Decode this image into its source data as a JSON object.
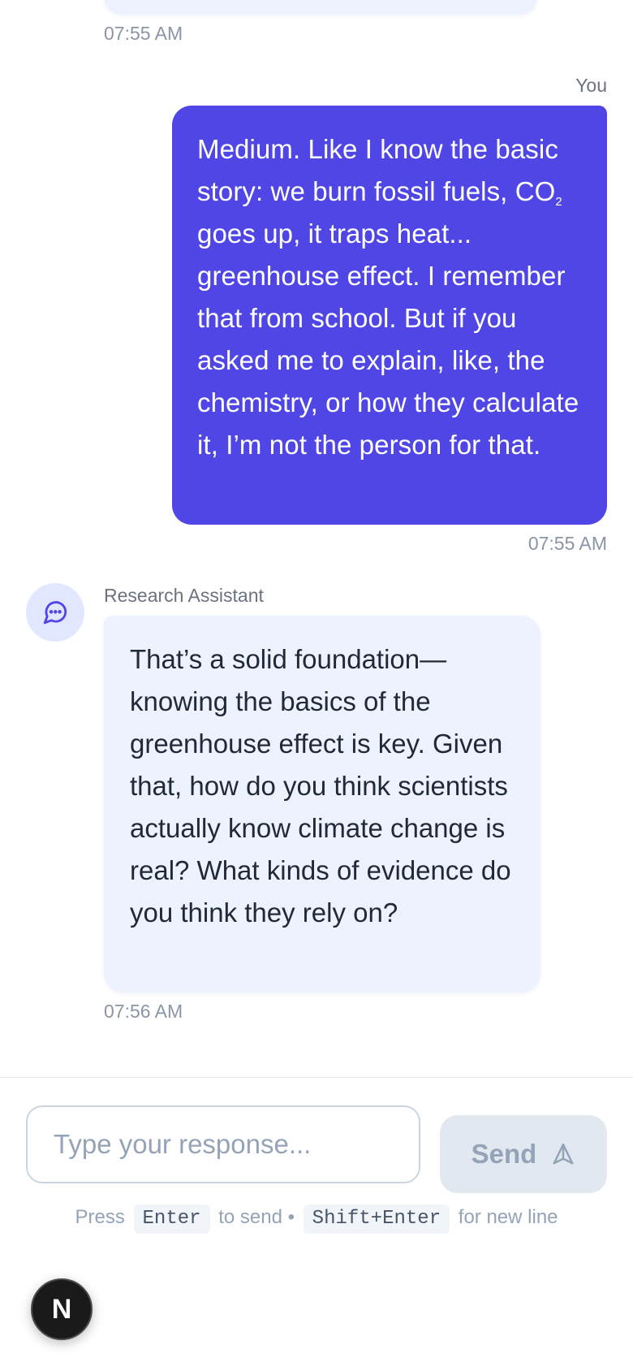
{
  "messages": {
    "previous": {
      "timestamp": "07:55 AM"
    },
    "user": {
      "sender": "You",
      "text_before_sub": "Medium. Like I know the basic story: we burn fossil fuels, CO",
      "subscript": "2",
      "text_after_sub": " goes up, it traps heat... greenhouse effect. I remember that from school. But if you asked me to explain, like, the chemistry, or how they calculate it, I’m not the person for that.",
      "timestamp": "07:55 AM"
    },
    "assistant": {
      "sender": "Research Assistant",
      "avatar_icon": "chat-bubble-icon",
      "text": "That’s a solid foundation—knowing the basics of the greenhouse effect is key. Given that, how do you think scientists actually know climate change is real? What kinds of evidence do you think they rely on?",
      "timestamp": "07:56 AM"
    }
  },
  "composer": {
    "placeholder": "Type your response...",
    "value": "",
    "send_label": "Send",
    "send_icon": "send-arrow-icon",
    "hint": {
      "press": "Press",
      "key_send": "Enter",
      "to_send": "to send •",
      "key_newline": "Shift+Enter",
      "for_newline": "for new line"
    }
  },
  "badge": {
    "letter": "N"
  },
  "colors": {
    "user_bubble": "#4f46e5",
    "assistant_bubble": "#eef2ff",
    "send_disabled": "#e2e8f0",
    "timestamp": "#8b95a7"
  }
}
